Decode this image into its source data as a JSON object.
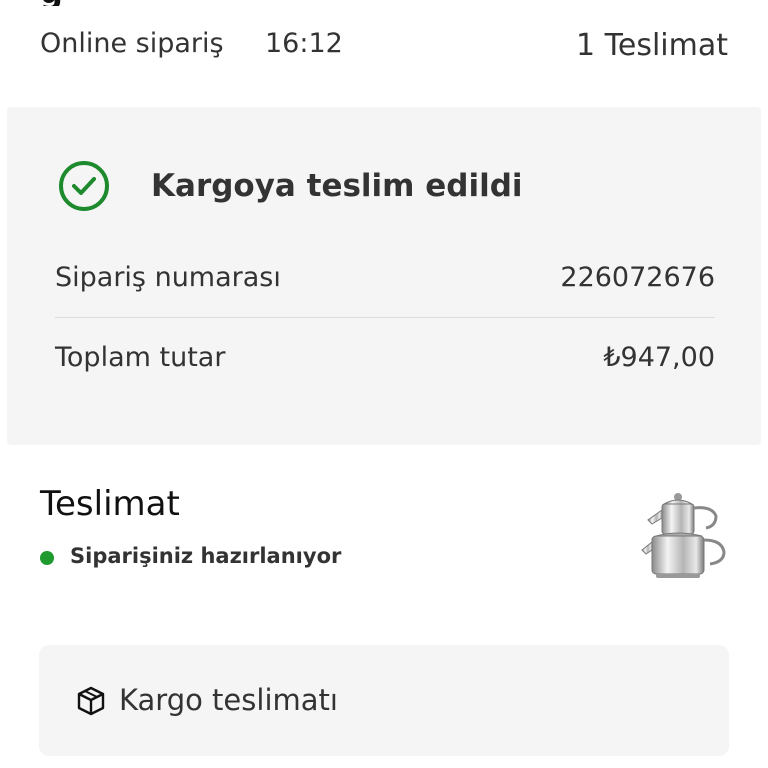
{
  "header": {
    "order_type": "Online sipariş",
    "order_time": "16:12",
    "delivery_count": "1 Teslimat"
  },
  "status_card": {
    "title": "Kargoya teslim edildi",
    "icon": "check-circle-icon",
    "rows": [
      {
        "label": "Sipariş numarası",
        "value": "226072676"
      },
      {
        "label": "Toplam tutar",
        "value": "₺947,00"
      }
    ]
  },
  "delivery": {
    "title": "Teslimat",
    "status_text": "Siparişiniz hazırlanıyor",
    "status_color": "#1e9a2e"
  },
  "shipping": {
    "label": "Kargo teslimatı",
    "icon": "box-icon"
  },
  "colors": {
    "accent_green": "#1e8a2e",
    "card_bg": "#f5f5f5"
  }
}
